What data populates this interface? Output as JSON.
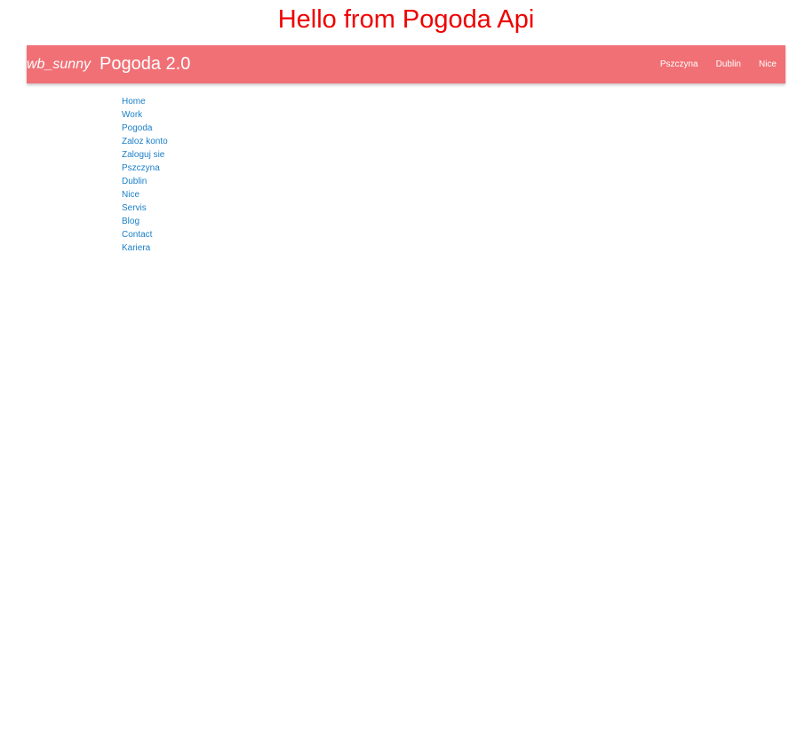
{
  "page": {
    "heading": "Hello from Pogoda Api"
  },
  "navbar": {
    "icon_text": "wb_sunny",
    "brand": "Pogoda 2.0",
    "links": [
      "Pszczyna",
      "Dublin",
      "Nice"
    ]
  },
  "sidebar": {
    "items": [
      "Home",
      "Work",
      "Pogoda",
      "Zaloz konto",
      "Zaloguj sie",
      "Pszczyna",
      "Dublin",
      "Nice",
      "Servis",
      "Blog",
      "Contact",
      "Kariera"
    ]
  },
  "colors": {
    "heading": "#ee0000",
    "navbar_bg": "#f07075",
    "link": "#1a7fc8"
  }
}
